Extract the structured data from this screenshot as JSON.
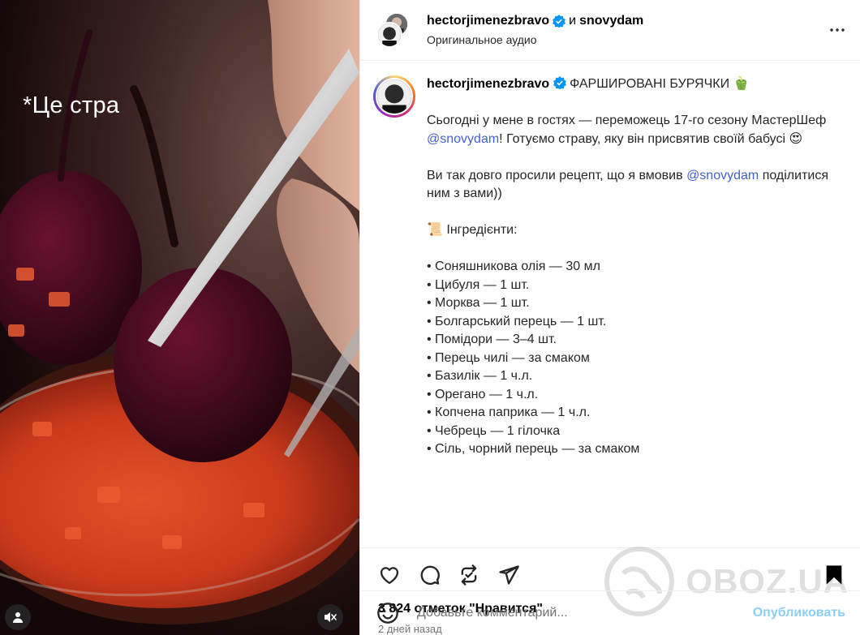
{
  "video": {
    "overlay_text": "*Це стра",
    "icons": {
      "profile": "person-icon",
      "mute": "speaker-muted-icon"
    }
  },
  "header": {
    "author": "hectorjimenezbravo",
    "conjunction": "и",
    "collaborator": "snovydam",
    "audio": "Оригинальное аудио"
  },
  "post": {
    "author": "hectorjimenezbravo",
    "title": "ФАРШИРОВАНІ БУРЯЧКИ",
    "title_emoji": "🫑",
    "intro_1": "Сьогодні у мене в гостях — переможець 17-го сезону МастерШеф",
    "mention_1": "@snovydam",
    "intro_2": "! Готуємо страву, яку він присвятив своїй бабусі",
    "intro_emoji": "😍",
    "p2_a": "Ви так довго просили рецепт, що я вмовив",
    "mention_2": "@snovydam",
    "p2_b": "поділитися ним з вами))",
    "ingredients_heading": "📜 Інгредієнти:",
    "ingredients": [
      "• Соняшникова олія — 30 мл",
      "• Цибуля — 1 шт.",
      "• Морква — 1 шт.",
      "• Болгарський перець — 1 шт.",
      "• Помідори — 3–4 шт.",
      "• Перець чилі — за смаком",
      "• Базилік — 1 ч.л.",
      "• Орегано — 1 ч.л.",
      "• Копчена паприка — 1 ч.л.",
      "• Чебрець — 1 гілочка",
      "• Сіль, чорний перець — за смаком"
    ]
  },
  "stats": {
    "likes": "3 824 отметок \"Нравится\"",
    "time": "2 дней назад"
  },
  "comment": {
    "placeholder": "Добавьте комментарий...",
    "publish": "Опубликовать"
  },
  "watermark": {
    "text": "OBOZ.UA"
  },
  "colors": {
    "link": "#4460d0",
    "accent": "#0095f6",
    "verified": "#0095f6"
  }
}
